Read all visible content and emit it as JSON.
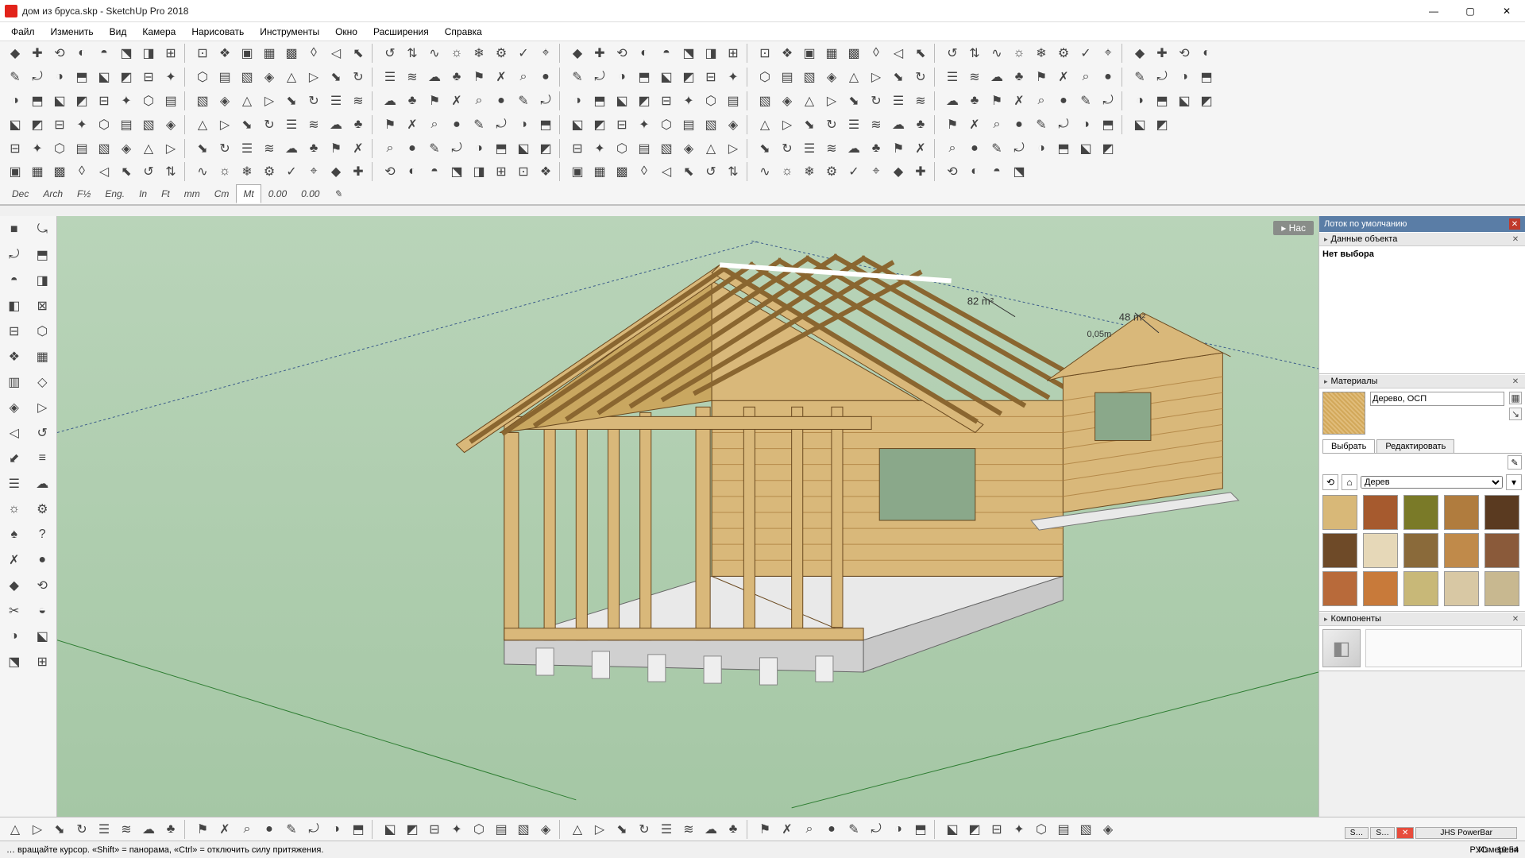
{
  "window": {
    "title": "дом из бруса.skp - SketchUp Pro 2018"
  },
  "menu": [
    "Файл",
    "Изменить",
    "Вид",
    "Камера",
    "Нарисовать",
    "Инструменты",
    "Окно",
    "Расширения",
    "Справка"
  ],
  "units": [
    "Dec",
    "Arch",
    "F½",
    "Eng.",
    "In",
    "Ft",
    "mm",
    "Cm",
    "Mt",
    "0.00",
    "0.00"
  ],
  "units_selected": "Mt",
  "scene_tag": "▸  Нас",
  "scene_labels": {
    "area1": "82 m²",
    "area2": "48 m²",
    "dim1": "0,05m"
  },
  "tray": {
    "title": "Лоток по умолчанию",
    "entity": {
      "title": "Данные объекта",
      "body": "Нет выбора"
    },
    "materials": {
      "title": "Материалы",
      "current_name": "Дерево, ОСП",
      "tabs": [
        "Выбрать",
        "Редактировать"
      ],
      "tab_selected": "Выбрать",
      "category": "Дерев",
      "swatches": [
        "#d8b878",
        "#a65a2e",
        "#7a7a28",
        "#b07c3e",
        "#5a3a20",
        "#6e4a28",
        "#e6d8b8",
        "#8a6a3a",
        "#c08a4a",
        "#8a5a3a",
        "#b86a3a",
        "#c87a3a",
        "#c8b878",
        "#d8c8a4",
        "#c8b890"
      ]
    },
    "components": {
      "title": "Компоненты"
    }
  },
  "status": {
    "hint": "… вращайте курсор. «Shift» = панорама, «Ctrl» = отключить силу притяжения.",
    "measure_label": "Измерени",
    "mini_tabs": [
      "S…",
      "S…",
      "✕",
      "JHS PowerBar"
    ]
  },
  "sys": {
    "lang": "РУС",
    "time": "10:54"
  }
}
